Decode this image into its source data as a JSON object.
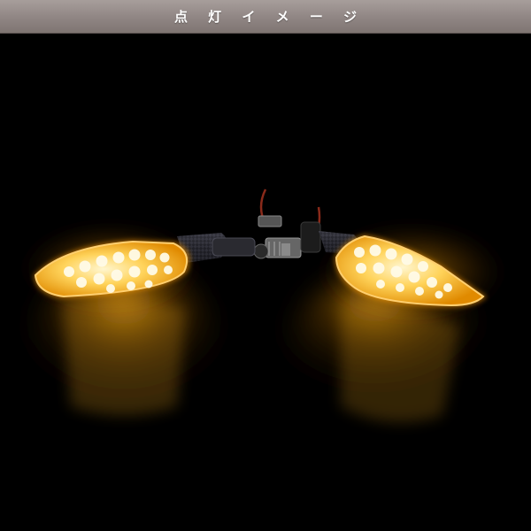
{
  "header": {
    "title": "点 灯 イ メ ー ジ"
  },
  "photo": {
    "subject": "lit-amber-led-turn-signals",
    "colors": {
      "background": "#000000",
      "header_bar": "#8f8583",
      "led_glow": "#ffb21a",
      "led_core": "#fff2c0",
      "carbon_stem": "#2a2a30"
    }
  }
}
